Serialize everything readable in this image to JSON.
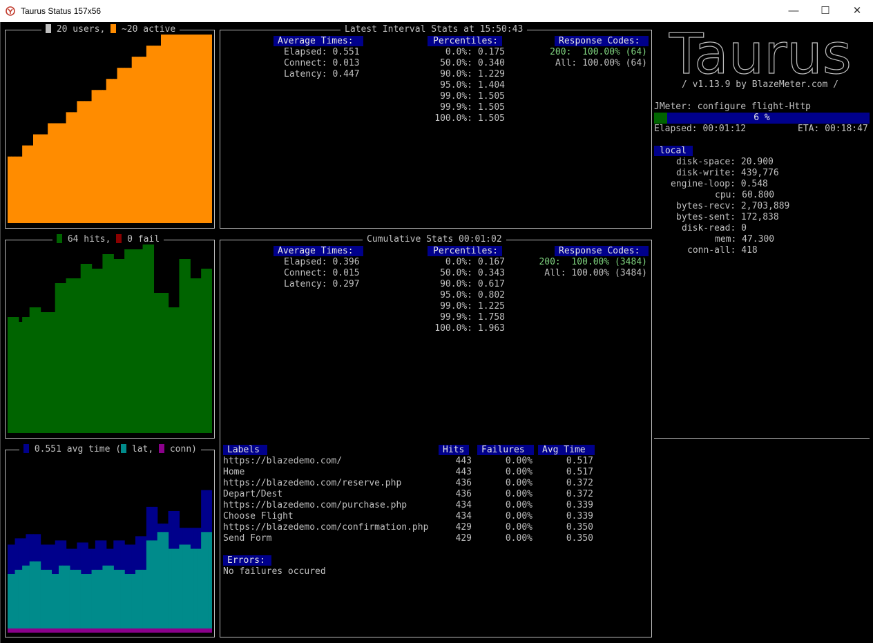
{
  "window": {
    "title": "Taurus Status 157x56",
    "minimize_icon": "minimize-icon",
    "maximize_icon": "maximize-icon",
    "close_icon": "close-icon"
  },
  "colors": {
    "users": "#c0c0c0",
    "active": "#ff8c00",
    "hits": "#006400",
    "fail": "#8b0000",
    "avg_time": "#00008b",
    "lat": "#008b8b",
    "conn": "#8b008b",
    "header_bg": "#00008b",
    "ok_text": "#7fd37f"
  },
  "users_chart": {
    "title_users": "20 users,",
    "title_active": "~20 active",
    "chart_data": {
      "type": "area",
      "series": [
        {
          "name": "~20 active",
          "values": [
            6,
            6,
            6,
            6,
            7,
            7,
            7,
            8,
            8,
            8,
            8,
            9,
            9,
            9,
            9,
            9,
            10,
            10,
            10,
            11,
            11,
            11,
            11,
            12,
            12,
            12,
            12,
            13,
            13,
            13,
            14,
            14,
            14,
            14,
            15,
            15,
            15,
            15,
            16,
            16,
            16,
            16,
            17,
            17,
            17,
            17,
            17,
            17,
            17,
            17,
            17,
            17,
            17,
            17,
            17,
            17
          ]
        }
      ],
      "ylim": [
        0,
        17
      ]
    }
  },
  "hits_chart": {
    "title_hits": "64 hits,",
    "title_fail": "0 fail",
    "chart_data": {
      "type": "bar",
      "series": [
        {
          "name": "hits",
          "values": [
            48,
            48,
            48,
            46,
            48,
            48,
            52,
            52,
            52,
            50,
            50,
            50,
            50,
            62,
            62,
            62,
            64,
            64,
            64,
            64,
            70,
            70,
            70,
            68,
            68,
            68,
            74,
            74,
            74,
            72,
            72,
            72,
            76,
            76,
            76,
            76,
            76,
            78,
            78,
            78,
            58,
            58,
            58,
            58,
            52,
            52,
            52,
            72,
            72,
            72,
            64,
            64,
            64,
            68,
            68,
            68
          ]
        },
        {
          "name": "fail",
          "values": [
            0,
            0,
            0,
            0,
            0,
            0,
            0,
            0,
            0,
            0,
            0,
            0,
            0,
            0,
            0,
            0,
            0,
            0,
            0,
            0,
            0,
            0,
            0,
            0,
            0,
            0,
            0,
            0,
            0,
            0,
            0,
            0,
            0,
            0,
            0,
            0,
            0,
            0,
            0,
            0,
            0,
            0,
            0,
            0,
            0,
            0,
            0,
            0,
            0,
            0,
            0,
            0,
            0,
            0,
            0,
            0
          ]
        }
      ]
    }
  },
  "times_chart": {
    "title_avg": "0.551 avg time (",
    "title_lat": "lat,",
    "title_conn": "conn)",
    "chart_data": {
      "type": "area",
      "series": [
        {
          "name": "avg time",
          "values": [
            0.42,
            0.42,
            0.45,
            0.45,
            0.45,
            0.47,
            0.47,
            0.47,
            0.47,
            0.42,
            0.42,
            0.42,
            0.42,
            0.44,
            0.44,
            0.44,
            0.4,
            0.4,
            0.4,
            0.43,
            0.43,
            0.43,
            0.4,
            0.4,
            0.44,
            0.44,
            0.44,
            0.4,
            0.4,
            0.44,
            0.44,
            0.44,
            0.42,
            0.42,
            0.42,
            0.46,
            0.46,
            0.46,
            0.6,
            0.6,
            0.6,
            0.52,
            0.52,
            0.52,
            0.58,
            0.58,
            0.58,
            0.5,
            0.5,
            0.5,
            0.5,
            0.5,
            0.5,
            0.68,
            0.68,
            0.68
          ]
        },
        {
          "name": "lat",
          "values": [
            0.28,
            0.28,
            0.3,
            0.3,
            0.32,
            0.32,
            0.34,
            0.34,
            0.34,
            0.3,
            0.3,
            0.3,
            0.28,
            0.28,
            0.32,
            0.32,
            0.32,
            0.3,
            0.3,
            0.3,
            0.28,
            0.28,
            0.28,
            0.3,
            0.3,
            0.3,
            0.32,
            0.32,
            0.32,
            0.3,
            0.3,
            0.3,
            0.28,
            0.28,
            0.28,
            0.3,
            0.3,
            0.3,
            0.44,
            0.44,
            0.44,
            0.48,
            0.48,
            0.48,
            0.4,
            0.4,
            0.4,
            0.42,
            0.42,
            0.42,
            0.4,
            0.4,
            0.4,
            0.48,
            0.48,
            0.48
          ]
        },
        {
          "name": "conn",
          "values": [
            0.02,
            0.02,
            0.02,
            0.02,
            0.02,
            0.02,
            0.02,
            0.02,
            0.02,
            0.02,
            0.02,
            0.02,
            0.02,
            0.02,
            0.02,
            0.02,
            0.02,
            0.02,
            0.02,
            0.02,
            0.02,
            0.02,
            0.02,
            0.02,
            0.02,
            0.02,
            0.02,
            0.02,
            0.02,
            0.02,
            0.02,
            0.02,
            0.02,
            0.02,
            0.02,
            0.02,
            0.02,
            0.02,
            0.02,
            0.02,
            0.02,
            0.02,
            0.02,
            0.02,
            0.02,
            0.02,
            0.02,
            0.02,
            0.02,
            0.02,
            0.02,
            0.02,
            0.02,
            0.02,
            0.02,
            0.02
          ]
        }
      ],
      "ylim": [
        0,
        0.85
      ]
    }
  },
  "latest": {
    "title": "Latest Interval Stats at 15:50:43",
    "avg_header": "Average Times:",
    "avg_lines": [
      "Elapsed: 0.551",
      "Connect: 0.013",
      "Latency: 0.447"
    ],
    "pct_header": "Percentiles:",
    "pct_lines": [
      "0.0%: 0.175",
      "50.0%: 0.340",
      "90.0%: 1.229",
      "95.0%: 1.404",
      "99.0%: 1.505",
      "99.9%: 1.505",
      "100.0%: 1.505"
    ],
    "rc_header": "Response Codes:",
    "rc_ok": "200:  100.00% (64)",
    "rc_all": "All: 100.00% (64)"
  },
  "cumulative": {
    "title": "Cumulative Stats 00:01:02",
    "avg_header": "Average Times:",
    "avg_lines": [
      "Elapsed: 0.396",
      "Connect: 0.015",
      "Latency: 0.297"
    ],
    "pct_header": "Percentiles:",
    "pct_lines": [
      "0.0%: 0.167",
      "50.0%: 0.343",
      "90.0%: 0.617",
      "95.0%: 0.802",
      "99.0%: 1.225",
      "99.9%: 1.758",
      "100.0%: 1.963"
    ],
    "rc_header": "Response Codes:",
    "rc_ok": "200:  100.00% (3484)",
    "rc_all": "All: 100.00% (3484)"
  },
  "labels_table": {
    "headers": {
      "labels": "Labels",
      "hits": "Hits",
      "failures": "Failures",
      "avg": "Avg Time"
    },
    "rows": [
      {
        "label": "https://blazedemo.com/",
        "hits": "443",
        "failures": "0.00%",
        "avg": "0.517"
      },
      {
        "label": "Home",
        "hits": "443",
        "failures": "0.00%",
        "avg": "0.517"
      },
      {
        "label": "https://blazedemo.com/reserve.php",
        "hits": "436",
        "failures": "0.00%",
        "avg": "0.372"
      },
      {
        "label": "Depart/Dest",
        "hits": "436",
        "failures": "0.00%",
        "avg": "0.372"
      },
      {
        "label": "https://blazedemo.com/purchase.php",
        "hits": "434",
        "failures": "0.00%",
        "avg": "0.339"
      },
      {
        "label": "Choose Flight",
        "hits": "434",
        "failures": "0.00%",
        "avg": "0.339"
      },
      {
        "label": "https://blazedemo.com/confirmation.php",
        "hits": "429",
        "failures": "0.00%",
        "avg": "0.350"
      },
      {
        "label": "Send Form",
        "hits": "429",
        "failures": "0.00%",
        "avg": "0.350"
      }
    ],
    "errors_header": "Errors:",
    "errors_text": "No failures occured"
  },
  "sidebar": {
    "logo_text": "Taurus",
    "version": "/ v1.13.9 by BlazeMeter.com /",
    "executor": "JMeter: configure flight-Http",
    "progress_label": "6 %",
    "progress": 0.06,
    "elapsed": "Elapsed: 00:01:12",
    "eta": "ETA: 00:18:47",
    "local_header": "local",
    "metrics": [
      "disk-space: 20.900",
      "disk-write: 439,776",
      "engine-loop: 0.548",
      "cpu: 60.800",
      "bytes-recv: 2,703,889",
      "bytes-sent: 172,838",
      "disk-read: 0",
      "mem: 47.300",
      "conn-all: 418"
    ]
  }
}
